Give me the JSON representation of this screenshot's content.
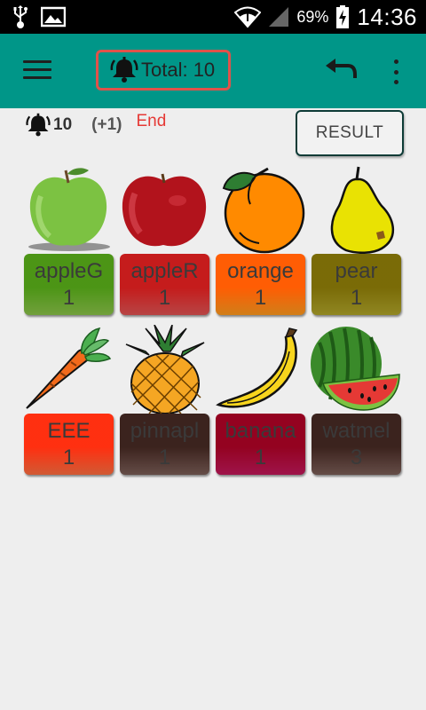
{
  "status_bar": {
    "battery_percent": "69%",
    "time": "14:36",
    "icons": [
      "usb-icon",
      "image-icon",
      "wifi-icon",
      "signal-icon",
      "battery-charging-icon"
    ]
  },
  "app_bar": {
    "total_label": "Total: 10",
    "icons": [
      "menu-icon",
      "bell-icon",
      "undo-icon",
      "more-vert-icon"
    ],
    "color": "#009688",
    "highlight_color": "#e0524a"
  },
  "info": {
    "bell_count": "10",
    "delta": "(+1)",
    "end_label": "End",
    "result_label": "RESULT"
  },
  "items": [
    {
      "name": "appleG",
      "count": "1",
      "color": "#8bc34a",
      "icon": "green-apple-icon"
    },
    {
      "name": "appleR",
      "count": "1",
      "color": "#e05454",
      "icon": "red-apple-icon"
    },
    {
      "name": "orange",
      "count": "1",
      "color": "#ff9a1e",
      "icon": "orange-icon"
    },
    {
      "name": "pear",
      "count": "1",
      "color": "#b0a52a",
      "icon": "pear-icon"
    },
    {
      "name": "EEE",
      "count": "1",
      "color": "#ff6e40",
      "icon": "carrot-icon"
    },
    {
      "name": "pinnapl",
      "count": "1",
      "color": "#7b5e57",
      "icon": "pineapple-icon"
    },
    {
      "name": "banana",
      "count": "1",
      "color": "#c2185b",
      "icon": "banana-icon"
    },
    {
      "name": "watmel",
      "count": "3",
      "color": "#7b5e57",
      "icon": "watermelon-icon"
    }
  ]
}
